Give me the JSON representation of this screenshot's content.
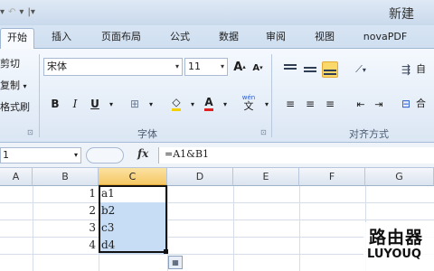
{
  "window": {
    "title": "新建"
  },
  "qat": {
    "icon1": "▾",
    "icon2": "↶",
    "icon3": "▾",
    "sep": "|▾"
  },
  "tabs": [
    {
      "label": "开始"
    },
    {
      "label": "插入"
    },
    {
      "label": "页面布局"
    },
    {
      "label": "公式"
    },
    {
      "label": "数据"
    },
    {
      "label": "审阅"
    },
    {
      "label": "视图"
    },
    {
      "label": "novaPDF"
    }
  ],
  "clipboard": {
    "cut": "剪切",
    "copy": "复制",
    "painter": "格式刷",
    "copy_arrow": "▾"
  },
  "font": {
    "name": "宋体",
    "size": "11",
    "grow": "A",
    "shrink": "A",
    "bold": "B",
    "italic": "I",
    "underline": "U",
    "group_label": "字体",
    "wen": "wén"
  },
  "alignment": {
    "group_label": "对齐方式",
    "wrap_label": "自",
    "merge_label": "合"
  },
  "formula_bar": {
    "name_box": "1",
    "fx": "fx",
    "formula": "=A1&B1"
  },
  "columns": [
    "A",
    "B",
    "C",
    "D",
    "E",
    "F",
    "G"
  ],
  "selected_column": "C",
  "rows": [
    {
      "b": "1",
      "c": "a1"
    },
    {
      "b": "2",
      "c": "b2"
    },
    {
      "b": "3",
      "c": "c3"
    },
    {
      "b": "4",
      "c": "d4"
    }
  ],
  "watermark": {
    "cn": "路由器",
    "en": "LUYOUQ"
  },
  "colors": {
    "accent": "#fbd86a",
    "selection": "#c7dcf5",
    "ribbon": "#dbe6f4"
  }
}
